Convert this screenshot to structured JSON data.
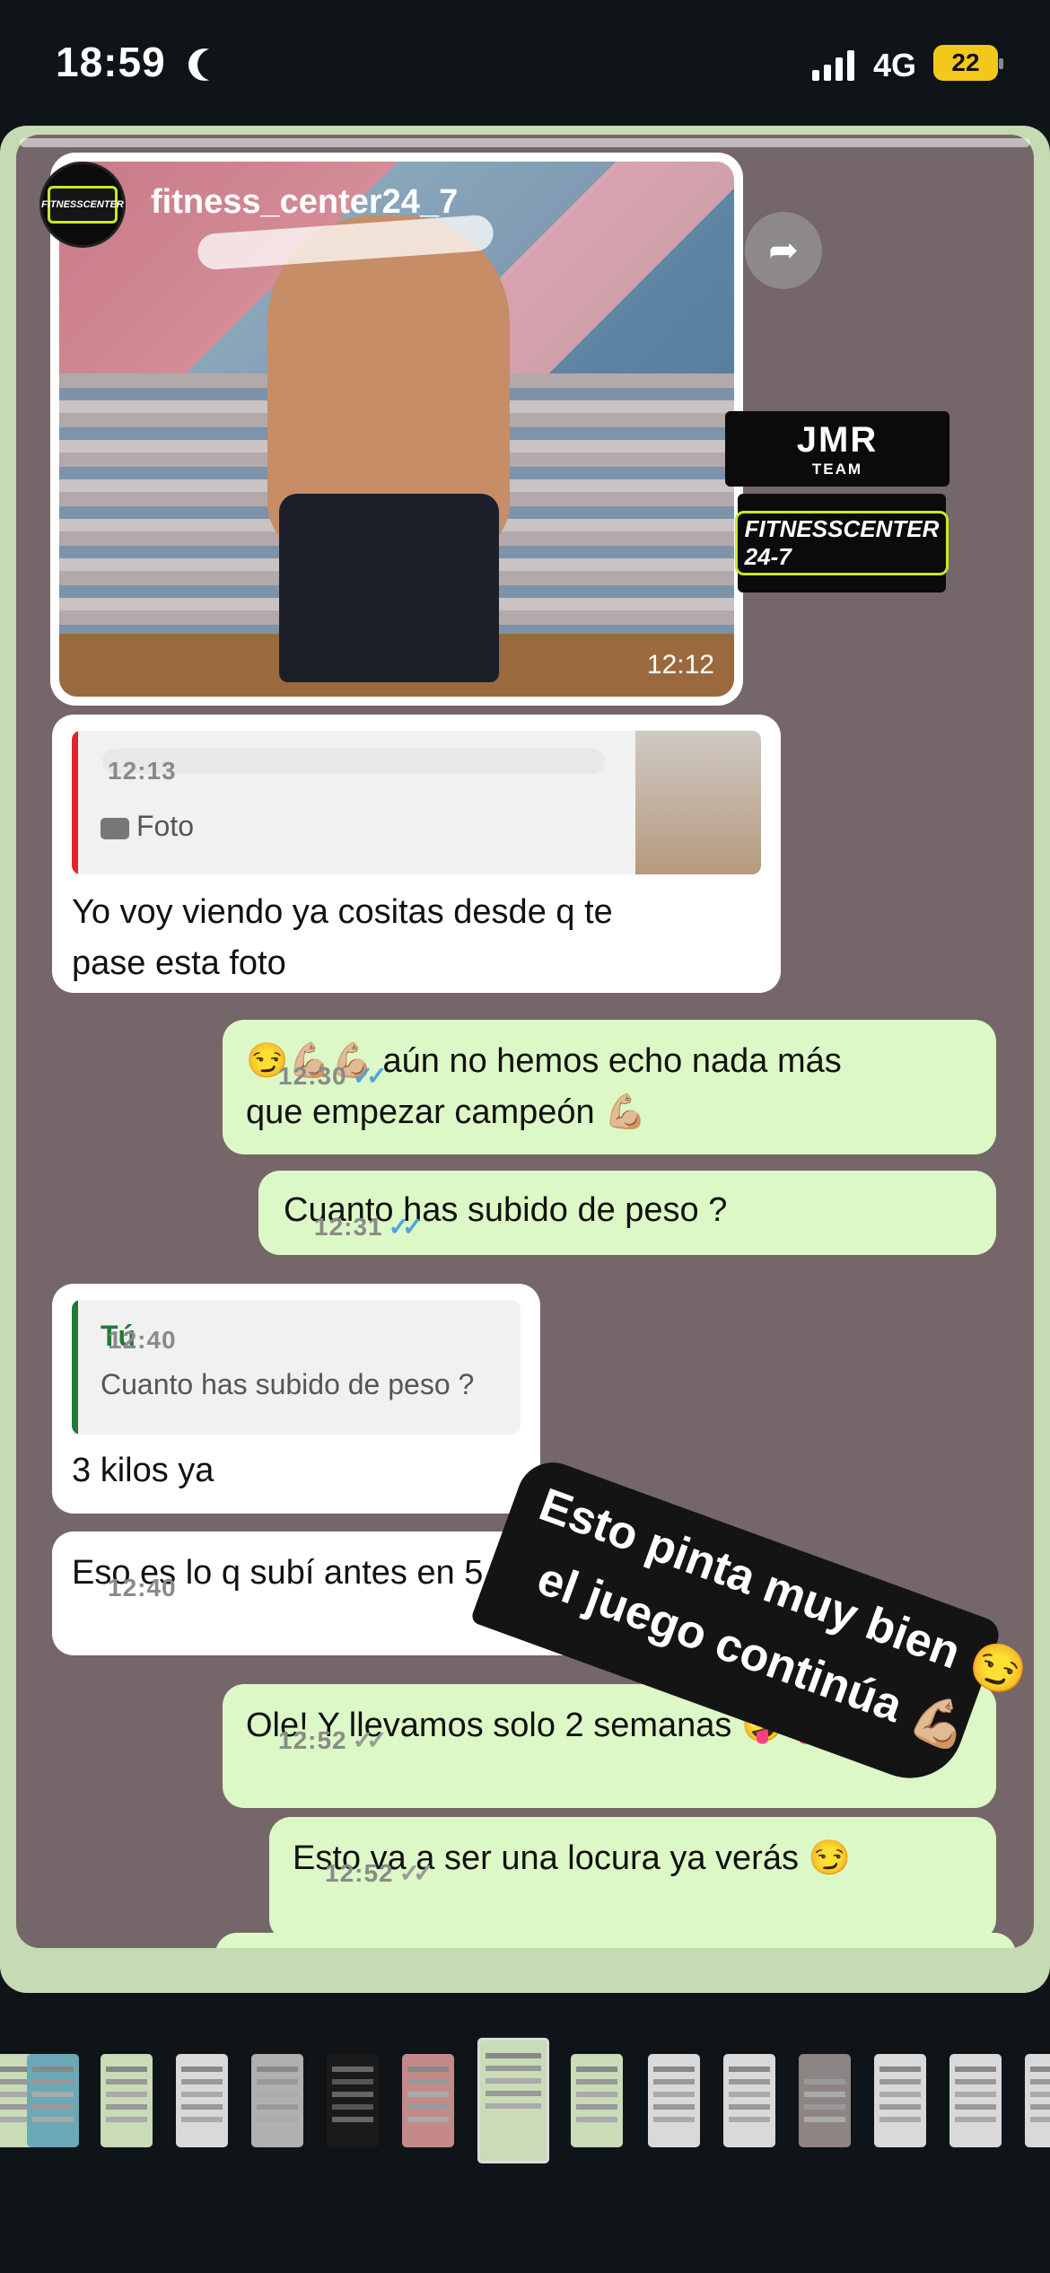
{
  "status_bar": {
    "time": "18:59",
    "network": "4G",
    "battery": "22"
  },
  "story": {
    "account": "fitness_center24_7",
    "avatar_logo": "FITNESSCENTER"
  },
  "logos": {
    "jmr": "JMR",
    "jmr_sub": "TEAM",
    "fitness": "FITNESSCENTER 24-7"
  },
  "photo_message": {
    "time": "12:12"
  },
  "messages": [
    {
      "id": "m1",
      "direction": "in",
      "quote": {
        "name": "",
        "text": "Foto"
      },
      "text_1": "Yo voy viendo ya cositas desde q te",
      "text_2": "pase esta foto",
      "time": "12:13"
    },
    {
      "id": "m2",
      "direction": "out",
      "text_1": "😏💪🏼💪🏼 aún no hemos echo nada más",
      "text_2": "que empezar campeón 💪🏼",
      "time": "12:30",
      "status": "read"
    },
    {
      "id": "m3",
      "direction": "out",
      "text": "Cuanto has subido de peso ?",
      "time": "12:31",
      "status": "read"
    },
    {
      "id": "m4",
      "direction": "in",
      "quote": {
        "name": "Tú",
        "text": "Cuanto has subido de peso ?"
      },
      "text": "3 kilos ya",
      "time": "12:40"
    },
    {
      "id": "m5",
      "direction": "in",
      "text": "Eso es lo q subí antes en 5 meses",
      "time": "12:40"
    },
    {
      "id": "m6",
      "direction": "out",
      "text": "Ole! Y llevamos solo 2 semanas 🤪🤪",
      "time": "12:52",
      "status": "delivered"
    },
    {
      "id": "m7",
      "direction": "out",
      "text": "Esto va a ser una locura ya verás 😏",
      "time": "12:52",
      "status": "delivered"
    }
  ],
  "sticker": {
    "line_1": "Esto pinta muy bien 😏",
    "line_2": "el juego continúa 💪🏼"
  },
  "colors": {
    "chat_background": "#756669",
    "incoming_bubble": "#ffffff",
    "outgoing_bubble": "#dcf8c6",
    "read_ticks": "#4fa3e0",
    "quote_green": "#1f7a3a",
    "quote_red": "#e0242f"
  }
}
